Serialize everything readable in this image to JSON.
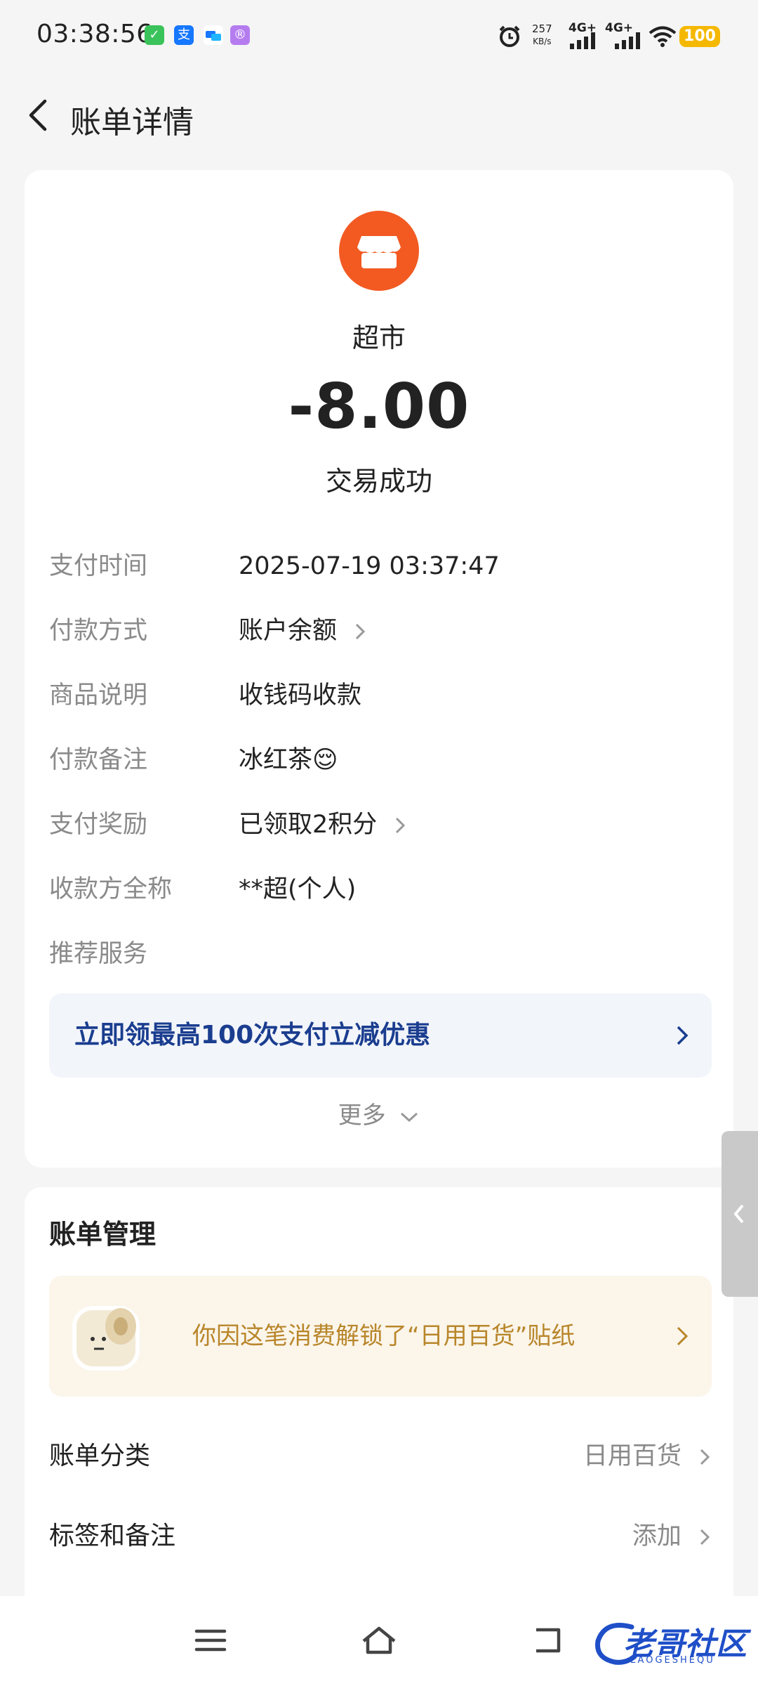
{
  "status_bar": {
    "time": "03:38:56",
    "net_speed_value": "257",
    "net_speed_unit": "KB/s",
    "network_1": "4G+",
    "network_2": "4G+",
    "battery": "100",
    "app_icons": [
      "wechat-icon",
      "alipay-icon",
      "dingtalk-icon",
      "app-icon"
    ],
    "icons": [
      "alarm-icon",
      "signal-icon",
      "wifi-icon",
      "battery-icon"
    ]
  },
  "header": {
    "title": "账单详情"
  },
  "transaction": {
    "merchant_name": "超市",
    "amount": "-8.00",
    "status": "交易成功",
    "merchant_icon_color": "#f25a22"
  },
  "details": [
    {
      "label": "支付时间",
      "value": "2025-07-19 03:37:47"
    },
    {
      "label": "付款方式",
      "value": "账户余额"
    },
    {
      "label": "商品说明",
      "value": "收钱码收款"
    },
    {
      "label": "付款备注",
      "value": "冰红茶😌"
    },
    {
      "label": "支付奖励",
      "value": "已领取2积分"
    },
    {
      "label": "收款方全称",
      "value": "**超(个人)"
    },
    {
      "label": "推荐服务",
      "value": ""
    }
  ],
  "promo": {
    "text": "立即领最高100次支付立减优惠"
  },
  "more": {
    "label": "更多"
  },
  "manage": {
    "title": "账单管理",
    "sticker_text": "你因这笔消费解锁了“日用百货”贴纸",
    "category_label": "账单分类",
    "category_value": "日用百货",
    "tags_label": "标签和备注",
    "tags_value": "添加"
  },
  "watermark": {
    "text": "老哥社区",
    "sub": "LAOGESHEQU"
  },
  "colors": {
    "accent_orange": "#f25a22",
    "promo_blue": "#1a3d8f",
    "sticker_gold": "#b8862a",
    "battery_yellow": "#f5b800"
  }
}
